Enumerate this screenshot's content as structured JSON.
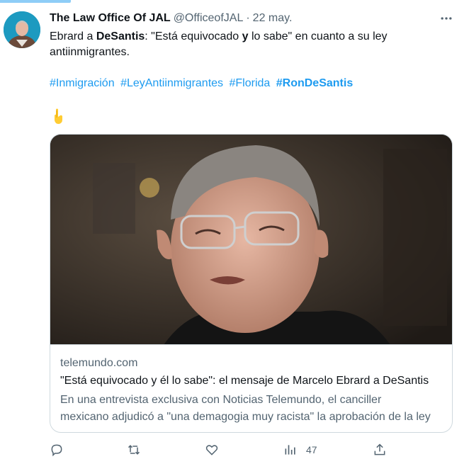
{
  "tweet": {
    "author_name": "The Law Office Of JAL",
    "author_handle": "@OfficeofJAL",
    "separator": "·",
    "date": "22 may.",
    "text_parts": {
      "p1": "Ebrard a ",
      "p2": "DeSantis",
      "p3": ":  \"Está equivocado ",
      "p4": "y",
      "p5": " lo sabe\" en cuanto a su ley antiinmigrantes."
    },
    "hashtags": [
      "#Inmigración",
      "#LeyAntiinmigrantes",
      "#Florida",
      "#RonDeSantis"
    ],
    "emoji": "👇"
  },
  "card": {
    "domain": "telemundo.com",
    "title": "\"Está equivocado y él lo sabe\": el mensaje de Marcelo Ebrard a DeSantis",
    "description_line1": "En una entrevista exclusiva con Noticias Telemundo, el canciller",
    "description_line2": "mexicano adjudicó a \"una demagogia muy racista\" la aprobación de la ley"
  },
  "actions": {
    "reply_icon": "reply-icon",
    "retweet_icon": "retweet-icon",
    "like_icon": "heart-icon",
    "views_icon": "views-icon",
    "views_count": "47",
    "share_icon": "share-icon"
  },
  "colors": {
    "accent": "#1d9bf0",
    "secondary_text": "#536471",
    "border": "#cfd9de"
  }
}
